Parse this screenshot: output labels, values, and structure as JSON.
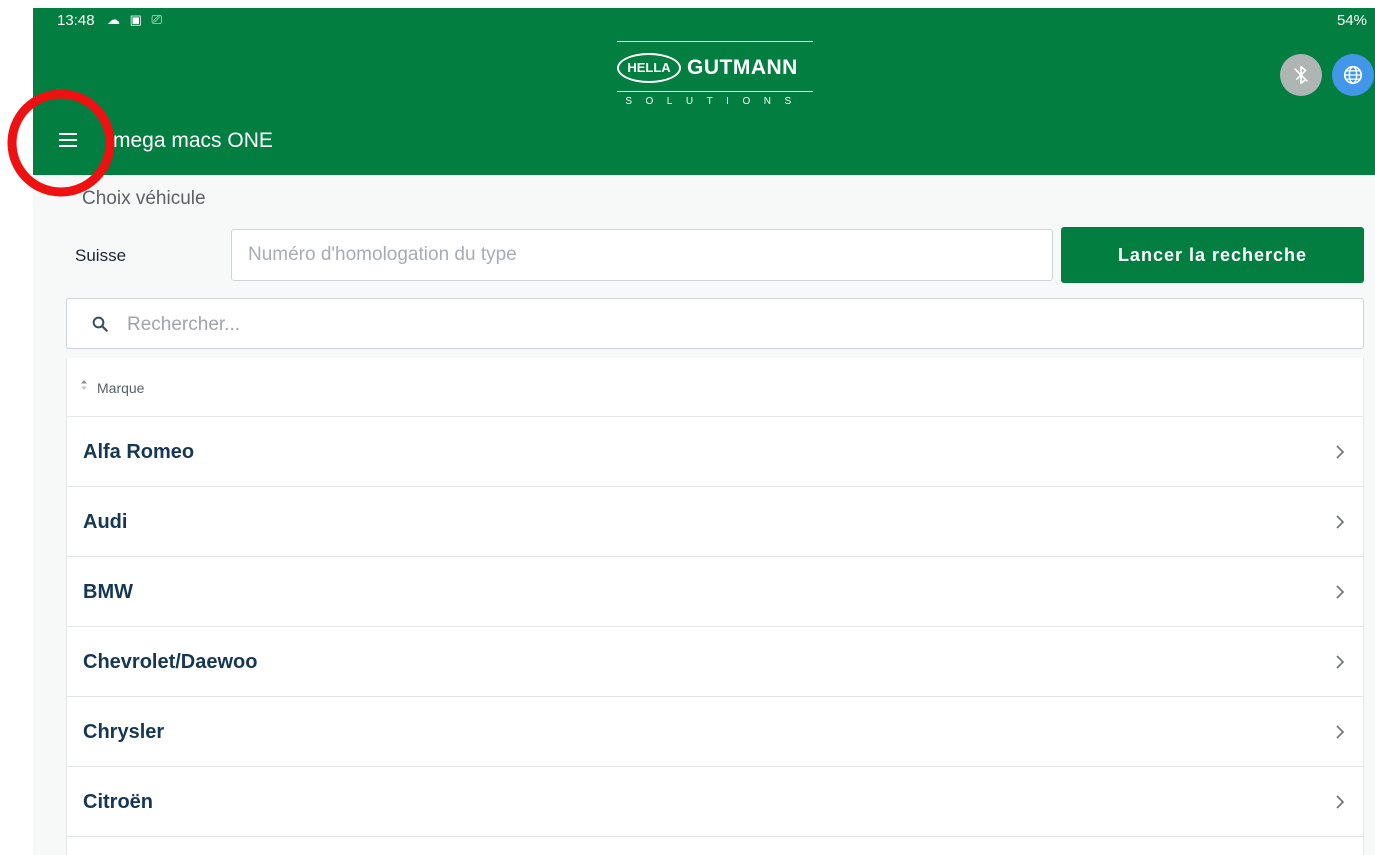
{
  "status_bar": {
    "time": "13:48",
    "icons_left": "☁ ▣ ⎚",
    "right": "54%"
  },
  "brand": {
    "hella": "HELLA",
    "gutmann": "GUTMANN",
    "solutions": "SOLUTIONS"
  },
  "app": {
    "title": "mega macs ONE"
  },
  "vehicle": {
    "section_title": "Choix véhicule",
    "country": "Suisse",
    "type_placeholder": "Numéro d'homologation du type",
    "search_button": "Lancer la recherche"
  },
  "search": {
    "placeholder": "Rechercher..."
  },
  "table": {
    "column": "Marque",
    "rows": [
      {
        "label": "Alfa Romeo"
      },
      {
        "label": "Audi"
      },
      {
        "label": "BMW"
      },
      {
        "label": "Chevrolet/Daewoo"
      },
      {
        "label": "Chrysler"
      },
      {
        "label": "Citroën"
      }
    ]
  },
  "colors": {
    "brand_green": "#017e40",
    "bluetooth_grey": "#aeb5b2",
    "globe_blue": "#4397e8",
    "row_text": "#153754"
  },
  "icons": [
    "menu-icon",
    "bluetooth-icon",
    "globe-icon",
    "search-icon",
    "sort-icon",
    "chevron-right-icon",
    "caret-down-icon"
  ]
}
